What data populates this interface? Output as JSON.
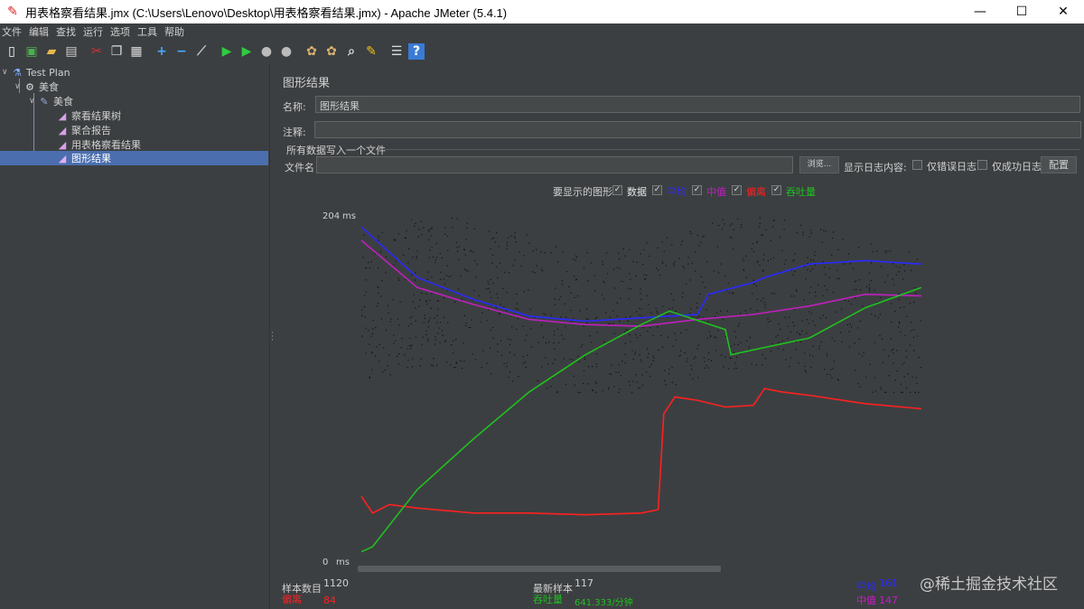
{
  "window": {
    "title": "用表格察看结果.jmx (C:\\Users\\Lenovo\\Desktop\\用表格察看结果.jmx) - Apache JMeter (5.4.1)",
    "minimize": "—",
    "maximize": "☐",
    "close": "✕"
  },
  "menu": [
    "文件",
    "编辑",
    "查找",
    "运行",
    "选项",
    "工具",
    "帮助"
  ],
  "toolbar_icons": [
    "new-icon",
    "templates-icon",
    "open-icon",
    "save-icon",
    "cut-icon",
    "copy-icon",
    "paste-icon",
    "expand-icon",
    "collapse-icon",
    "toggle-icon",
    "start-icon",
    "start-no-pause-icon",
    "stop-icon",
    "shutdown-icon",
    "clear-icon",
    "clear-all-icon",
    "search-icon",
    "reset-search-icon",
    "function-helper-icon",
    "help-icon"
  ],
  "tree": {
    "test_plan": "Test Plan",
    "thread_group": "美食",
    "sampler": "美食",
    "listeners": [
      "察看结果树",
      "聚合报告",
      "用表格察看结果",
      "图形结果"
    ],
    "selected_index": 3
  },
  "panel": {
    "title": "图形结果",
    "name_label": "名称:",
    "name_value": "图形结果",
    "comment_label": "注释:",
    "comment_value": "",
    "group_title": "所有数据写入一个文件",
    "file_label": "文件名",
    "file_value": "",
    "browse_label": "浏览...",
    "log_display_label": "显示日志内容:",
    "errors_only_label": "仅错误日志",
    "success_only_label": "仅成功日志",
    "configure_label": "配置"
  },
  "graph_options": {
    "label": "要显示的图形",
    "items": [
      {
        "label": "数据",
        "color": "#e6e6e6",
        "checked": true
      },
      {
        "label": "平均",
        "color": "#2a2aff",
        "checked": true
      },
      {
        "label": "中值",
        "color": "#c020c0",
        "checked": true
      },
      {
        "label": "偏离",
        "color": "#ff2020",
        "checked": true
      },
      {
        "label": "吞吐量",
        "color": "#20c020",
        "checked": true
      }
    ]
  },
  "chart_data": {
    "type": "line",
    "ylim": [
      0,
      204
    ],
    "y_max_label": "204",
    "y_min_label": "0",
    "y_unit": "ms",
    "series": [
      {
        "name": "平均",
        "color": "#2a2aff",
        "x": [
          0,
          10,
          20,
          30,
          40,
          50,
          60,
          62,
          70,
          72,
          80,
          90,
          100
        ],
        "values": [
          198,
          168,
          155,
          145,
          142,
          144,
          146,
          158,
          165,
          168,
          176,
          178,
          176
        ]
      },
      {
        "name": "中值",
        "color": "#c020c0",
        "x": [
          0,
          10,
          20,
          30,
          40,
          50,
          60,
          70,
          80,
          90,
          100
        ],
        "values": [
          190,
          162,
          152,
          143,
          140,
          139,
          143,
          146,
          151,
          158,
          157
        ]
      },
      {
        "name": "偏离",
        "color": "#ff2020",
        "x": [
          0,
          2,
          5,
          10,
          20,
          30,
          40,
          50,
          53,
          54,
          56,
          60,
          65,
          70,
          72,
          75,
          80,
          90,
          100
        ],
        "values": [
          38,
          28,
          33,
          31,
          28,
          28,
          27,
          28,
          30,
          87,
          97,
          95,
          91,
          92,
          102,
          100,
          98,
          93,
          90
        ]
      },
      {
        "name": "吞吐量",
        "color": "#20c020",
        "x": [
          0,
          2,
          10,
          20,
          30,
          40,
          50,
          55,
          65,
          66,
          70,
          80,
          90,
          100
        ],
        "values": [
          5,
          8,
          42,
          72,
          100,
          122,
          140,
          148,
          137,
          122,
          125,
          132,
          150,
          162
        ]
      }
    ]
  },
  "stats": {
    "samples_label": "样本数目",
    "samples_value": "1120",
    "deviation_label": "偏离",
    "deviation_value": "84",
    "latest_label": "最新样本",
    "latest_value": "117",
    "throughput_label": "吞吐量",
    "throughput_value": "641.333/分钟",
    "average_label": "平均",
    "average_value": "161",
    "median_label": "中值",
    "median_value": "147"
  },
  "watermark": "@稀土掘金技术社区"
}
